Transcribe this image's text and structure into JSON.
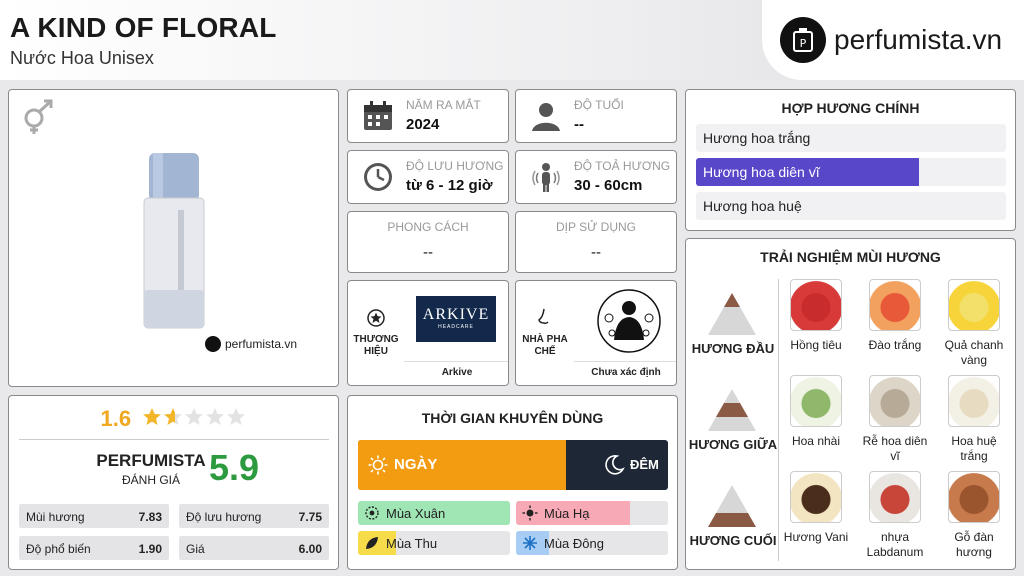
{
  "header": {
    "title": "A KIND OF FLORAL",
    "subtitle": "Nước Hoa Unisex",
    "brand_site": "perfumista.vn"
  },
  "product": {
    "watermark": "perfumista.vn",
    "gender_icon": "gender-unisex-icon"
  },
  "info": {
    "release_label": "NĂM RA MẮT",
    "release_value": "2024",
    "age_label": "ĐỘ TUỔI",
    "age_value": "--",
    "longevity_label": "ĐỘ LƯU HƯƠNG",
    "longevity_value": "từ 6 - 12 giờ",
    "sillage_label": "ĐỘ TOẢ HƯƠNG",
    "sillage_value": "30 - 60cm",
    "style_label": "PHONG CÁCH",
    "style_value": "--",
    "occasion_label": "DỊP SỬ DỤNG",
    "occasion_value": "--",
    "brand_label_1": "THƯƠNG",
    "brand_label_2": "HIỆU",
    "brand_logo_text": "ARKIVE",
    "brand_logo_sub": "HEADCARE",
    "brand_name": "Arkive",
    "perfumer_label_1": "NHÀ PHA",
    "perfumer_label_2": "CHẾ",
    "perfumer_name": "Chưa xác định"
  },
  "accords": {
    "title": "HỢP HƯƠNG CHÍNH",
    "items": [
      {
        "label": "Hương hoa trắng",
        "level": 0.0
      },
      {
        "label": "Hương hoa diên vĩ",
        "level": 0.72
      },
      {
        "label": "Hương hoa huệ",
        "level": 0.0
      }
    ]
  },
  "notes": {
    "title": "TRẢI NGHIỆM MÙI HƯƠNG",
    "tiers": [
      {
        "label": "HƯƠNG ĐẦU",
        "items": [
          "Hồng tiêu",
          "Đào trắng",
          "Quả chanh vàng"
        ]
      },
      {
        "label": "HƯƠNG GIỮA",
        "items": [
          "Hoa nhài",
          "Rễ hoa diên vĩ",
          "Hoa huệ trắng"
        ]
      },
      {
        "label": "HƯƠNG CUỐI",
        "items": [
          "Hương Vani",
          "nhựa Labdanum",
          "Gỗ đàn hương"
        ]
      }
    ]
  },
  "rating": {
    "score": "1.6",
    "stars": 1.6,
    "perfumista_label": "PERFUMISTA",
    "perfumista_sub": "ĐÁNH GIÁ",
    "perfumista_score": "5.9",
    "rows": [
      {
        "label": "Mùi hương",
        "value": "7.83"
      },
      {
        "label": "Độ lưu hương",
        "value": "7.75"
      },
      {
        "label": "Độ phổ biến",
        "value": "1.90"
      },
      {
        "label": "Giá",
        "value": "6.00"
      }
    ]
  },
  "timing": {
    "title": "THỜI GIAN KHUYÊN DÙNG",
    "day_label": "NGÀY",
    "night_label": "ĐÊM",
    "day_share": 0.67,
    "seasons": [
      {
        "label": "Mùa Xuân",
        "level": 1.0,
        "color": "#9fe6b4"
      },
      {
        "label": "Mùa Hạ",
        "level": 0.75,
        "color": "#f7a9b6"
      },
      {
        "label": "Mùa Thu",
        "level": 0.25,
        "color": "#f6dc4a"
      },
      {
        "label": "Mùa Đông",
        "level": 0.22,
        "color": "#a7cdf5"
      }
    ]
  }
}
